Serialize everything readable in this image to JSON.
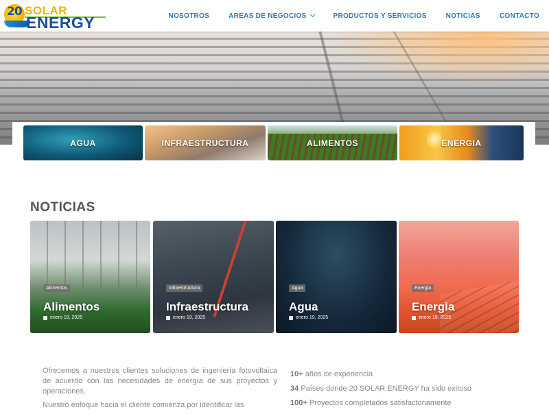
{
  "header": {
    "logo_number": "20",
    "logo_word1": "SOLAR",
    "logo_word2": "ENERGY",
    "nav": [
      {
        "label": "NOSOTROS"
      },
      {
        "label": "AREAS DE NEGOCIOS"
      },
      {
        "label": "PRODUCTOS Y SERVICIOS"
      },
      {
        "label": "NOTICIAS"
      },
      {
        "label": "CONTACTO"
      }
    ]
  },
  "categories": [
    {
      "label": "AGUA"
    },
    {
      "label": "INFRAESTRUCTURA"
    },
    {
      "label": "ALIMENTOS"
    },
    {
      "label": "ENERGIA"
    }
  ],
  "noticias": {
    "title": "NOTICIAS",
    "cards": [
      {
        "tag": "Alimentos",
        "title": "Alimentos",
        "date": "enero 19, 2025"
      },
      {
        "tag": "Infraestructura",
        "title": "Infraestructura",
        "date": "enero 19, 2025"
      },
      {
        "tag": "Agua",
        "title": "Agua",
        "date": "enero 19, 2025"
      },
      {
        "tag": "Energia",
        "title": "Energia",
        "date": "enero 19, 2025"
      }
    ]
  },
  "about": {
    "paragraph1": "Ofrecemos a nuestros clientes soluciones de ingeniería fotovoltaica de acuerdo con las necesidades de energía de sus proyectos y operaciones.",
    "paragraph2": "Nuestro enfoque hacia el cliente comienza por identificar las",
    "stats": [
      {
        "value": "10+",
        "text": " años de experiencia"
      },
      {
        "value": "34",
        "text": " Países donde 20 SOLAR ENERGY ha sido exitoso"
      },
      {
        "value": "100+",
        "text": " Proyectos completados satisfactoriamente"
      }
    ]
  },
  "colors": {
    "nav_text": "#2a7ab8",
    "logo_blue": "#1d4f9c",
    "logo_yellow": "#f0b400",
    "heading_gray": "#555555",
    "body_gray": "#888888"
  }
}
